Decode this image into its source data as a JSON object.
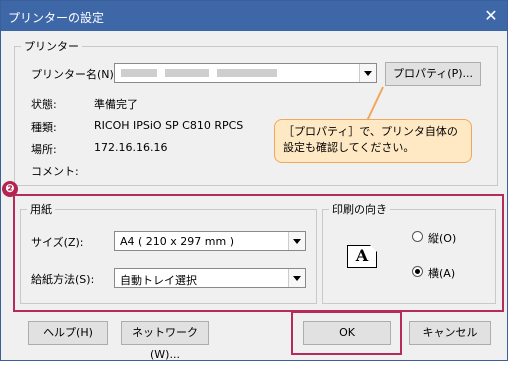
{
  "window": {
    "title": "プリンターの設定",
    "close": "✕"
  },
  "printer": {
    "group": "プリンター",
    "name_label": "プリンター名(N):",
    "properties_button": "プロパティ(P)...",
    "status_label": "状態:",
    "status_value": "準備完了",
    "type_label": "種類:",
    "type_value": "RICOH IPSiO SP C810 RPCS",
    "location_label": "場所:",
    "location_value": "172.16.16.16",
    "comment_label": "コメント:"
  },
  "callout": {
    "line1": "［プロパティ］で、プリンタ自体の",
    "line2": "設定も確認してください。"
  },
  "badge": "❷",
  "paper": {
    "group": "用紙",
    "size_label": "サイズ(Z):",
    "size_value": "A4 ( 210 x 297 mm )",
    "source_label": "給紙方法(S):",
    "source_value": "自動トレイ選択"
  },
  "orientation": {
    "group": "印刷の向き",
    "portrait": "縦(O)",
    "landscape": "横(A)",
    "icon": "A"
  },
  "buttons": {
    "help": "ヘルプ(H)",
    "network": "ネットワーク(W)...",
    "ok": "OK",
    "cancel": "キャンセル"
  },
  "colors": {
    "title_bar": "#3e67a8",
    "highlight": "#b52b5a",
    "callout_fill": "#ffe9c4",
    "callout_border": "#f0a85a"
  }
}
